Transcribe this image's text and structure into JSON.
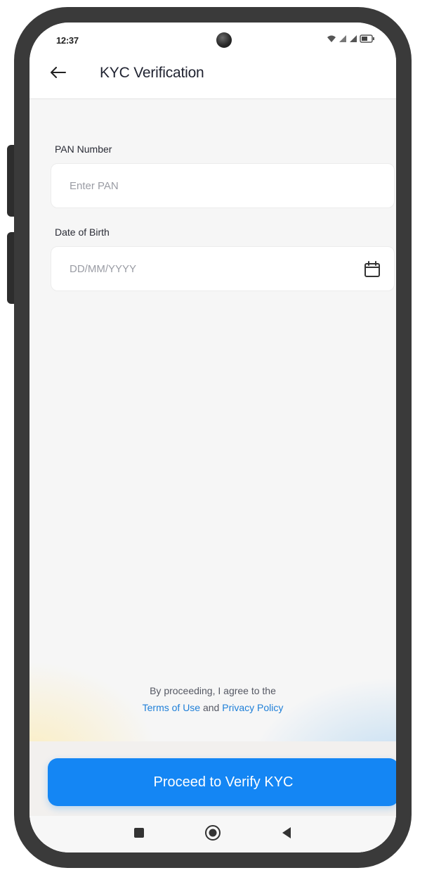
{
  "status_bar": {
    "time": "12:37",
    "icons": [
      "wifi-icon",
      "signal-icon",
      "signal-icon",
      "battery-icon"
    ]
  },
  "app_bar": {
    "back_icon": "arrow-left-icon",
    "title": "KYC Verification"
  },
  "form": {
    "pan": {
      "label": "PAN Number",
      "value": "",
      "placeholder": "Enter PAN"
    },
    "dob": {
      "label": "Date of Birth",
      "value": "",
      "placeholder": "DD/MM/YYYY",
      "icon": "calendar-icon"
    }
  },
  "consent": {
    "prefix": "By proceeding, I agree to the",
    "terms_link": "Terms of Use",
    "conjunction": "and",
    "privacy_link": "Privacy Policy"
  },
  "cta": {
    "label": "Proceed to Verify KYC"
  },
  "nav_bar": {
    "buttons": [
      "recents-square-icon",
      "home-circle-icon",
      "back-triangle-icon"
    ]
  },
  "colors": {
    "accent": "#1486f4",
    "link": "#1e7fd8",
    "background": "#f6f6f6",
    "device_frame": "#3a3a3a"
  }
}
